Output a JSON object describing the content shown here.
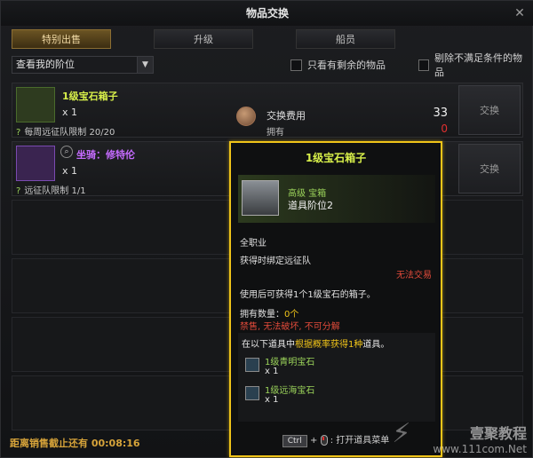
{
  "window": {
    "title": "物品交换",
    "close_icon": "close-icon"
  },
  "tabs": [
    {
      "label": "特别出售",
      "active": true
    },
    {
      "label": "升级",
      "active": false
    },
    {
      "label": "船员",
      "active": false
    }
  ],
  "filters": {
    "tier_select": "查看我的阶位",
    "only_remaining": "只看有剩余的物品",
    "exclude_unmet": "剔除不满足条件的物品"
  },
  "rows": [
    {
      "name": "1级宝石箱子",
      "name_color": "#d8f04a",
      "qty": "x 1",
      "limit": "每周远征队限制 20/20",
      "exchange": "交换",
      "fee_label": "交换费用",
      "fee_value": "33",
      "own_label": "拥有",
      "own_value": "0"
    },
    {
      "name": "坐骑：修特伦",
      "name_color": "#c56bff",
      "qty": "x 1",
      "limit": "远征队限制 1/1",
      "exchange": "交换"
    }
  ],
  "footer": {
    "countdown_label": "距离销售截止还有",
    "countdown_value": "00:08:16"
  },
  "tooltip": {
    "title": "1级宝石箱子",
    "grade": "高级 宝箱",
    "item_level": "道具阶位2",
    "class": "全职业",
    "binding": "获得时绑定远征队",
    "no_trade": "无法交易",
    "description": "使用后可获得1个1级宝石的箱子。",
    "owned_label": "拥有数量：",
    "owned_value": "0个",
    "restrictions": "禁售, 无法破坏, 不可分解",
    "pool_hint_prefix": "在以下道具中",
    "pool_hint_highlight": "根据概率获得1种",
    "pool_hint_suffix": "道具。",
    "gems": [
      {
        "name": "1级青明宝石",
        "qty": "x 1"
      },
      {
        "name": "1级远海宝石",
        "qty": "x 1"
      }
    ],
    "key_ctrl": "Ctrl",
    "open_preview": ": 打开道具菜单"
  },
  "watermark": {
    "brand": "壹聚教程",
    "url": "www.111com.Net"
  }
}
